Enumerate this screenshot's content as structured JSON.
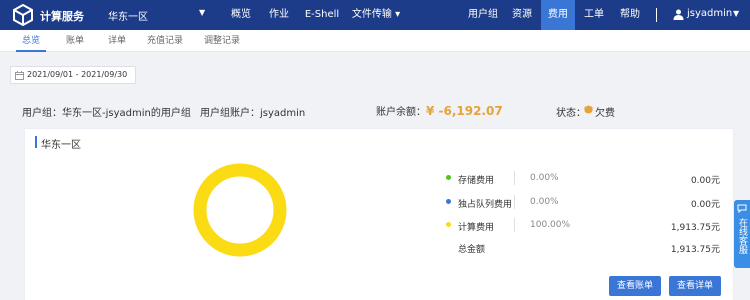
{
  "header": {
    "brand": "计算服务",
    "region": "华东一区",
    "nav": [
      {
        "label": "概览"
      },
      {
        "label": "作业"
      },
      {
        "label": "E-Shell"
      },
      {
        "label": "文件传输 ▾"
      },
      {
        "label": "用户组"
      },
      {
        "label": "资源"
      },
      {
        "label": "费用"
      },
      {
        "label": "工单"
      },
      {
        "label": "帮助"
      }
    ],
    "active_nav": "费用",
    "user": "jsyadmin"
  },
  "tabs": [
    {
      "label": "总览"
    },
    {
      "label": "账单"
    },
    {
      "label": "详单"
    },
    {
      "label": "充值记录"
    },
    {
      "label": "调整记录"
    }
  ],
  "active_tab": "总览",
  "date_range": "2021/09/01  -  2021/09/30",
  "summary": {
    "group_label": "用户组：华东一区-jsyadmin的用户组",
    "account_label": "用户组账户：jsyadmin",
    "balance_label": "账户余额：",
    "balance_value": "¥ -6,192.07",
    "status_label": "状态：",
    "status_value": "欠费"
  },
  "card": {
    "title": "华东一区",
    "items": [
      {
        "label": "存储费用",
        "percent": "0.00%",
        "amount": "0.00元",
        "color": "#52c41a"
      },
      {
        "label": "独占队列费用",
        "percent": "0.00%",
        "amount": "0.00元",
        "color": "#3a76d6"
      },
      {
        "label": "计算费用",
        "percent": "100.00%",
        "amount": "1,913.75元",
        "color": "#fadb14"
      }
    ],
    "total_label": "总金额",
    "total_amount": "1,913.75元",
    "view_bill_button": "查看账单",
    "view_detail_button": "查看详单"
  },
  "service": {
    "label": "在线客服"
  },
  "colors": {
    "nav_bg": "#1c3c8a",
    "accent": "#3a76d6",
    "donut": "#fadb14",
    "balance": "#e6a23c",
    "status": "#e6a23c"
  }
}
